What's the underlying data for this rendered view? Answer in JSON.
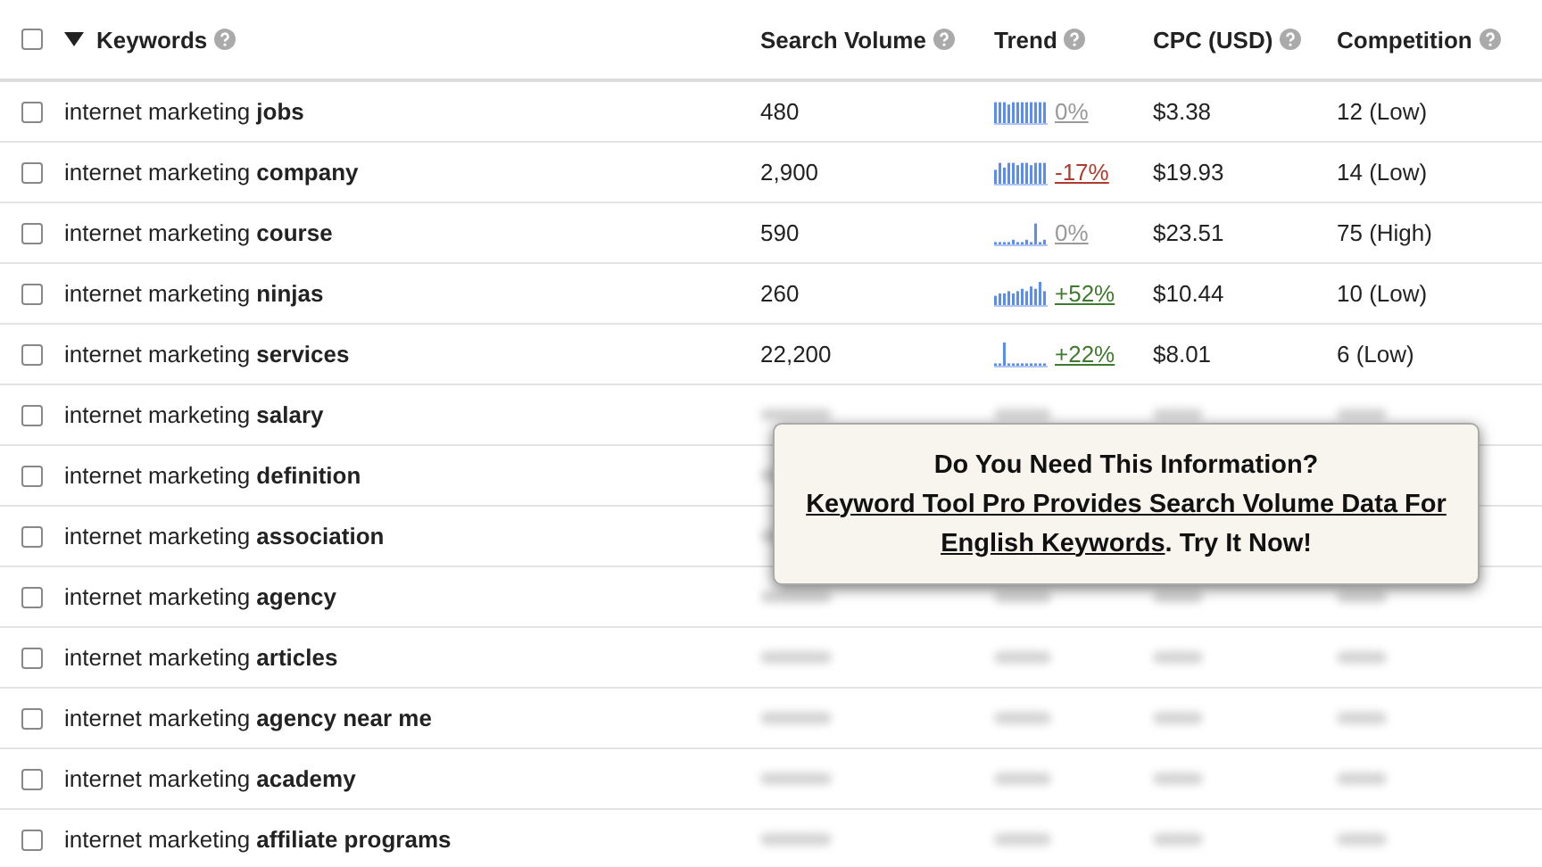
{
  "table": {
    "all_checked": false,
    "columns": [
      {
        "label": "Keywords",
        "sorted": true
      },
      {
        "label": "Search Volume",
        "sorted": false
      },
      {
        "label": "Trend",
        "sorted": false
      },
      {
        "label": "CPC (USD)",
        "sorted": false
      },
      {
        "label": "Competition",
        "sorted": false
      }
    ],
    "rows": [
      {
        "keyword": "internet marketing **jobs**",
        "checked": false,
        "locked": false,
        "volume": "480",
        "trend_change": "0%",
        "color": "#999999",
        "cpc": "$3.38",
        "competition": "12 (Low)"
      },
      {
        "keyword": "internet marketing **company**",
        "checked": false,
        "locked": false,
        "volume": "2,900",
        "trend_change": "-17%",
        "color": "#b03a2e",
        "cpc": "$19.93",
        "competition": "14 (Low)"
      },
      {
        "keyword": "internet marketing **course**",
        "checked": false,
        "locked": false,
        "volume": "590",
        "trend_change": "0%",
        "color": "#999999",
        "cpc": "$23.51",
        "competition": "75 (High)"
      },
      {
        "keyword": "internet marketing **ninjas**",
        "checked": false,
        "locked": false,
        "volume": "260",
        "trend_change": "+52%",
        "color": "#3f7a2e",
        "cpc": "$10.44",
        "competition": "10 (Low)"
      },
      {
        "keyword": "internet marketing **services**",
        "checked": false,
        "locked": false,
        "volume": "22,200",
        "trend_change": "+22%",
        "color": "#3f7a2e",
        "cpc": "$8.01",
        "competition": "6 (Low)"
      },
      {
        "keyword": "internet marketing **salary**",
        "checked": false,
        "locked": true
      },
      {
        "keyword": "internet marketing **definition**",
        "checked": false,
        "locked": true
      },
      {
        "keyword": "internet marketing **association**",
        "checked": false,
        "locked": true
      },
      {
        "keyword": "internet marketing **agency**",
        "checked": false,
        "locked": true
      },
      {
        "keyword": "internet marketing **articles**",
        "checked": false,
        "locked": true
      },
      {
        "keyword": "internet marketing **agency near me**",
        "checked": false,
        "locked": true
      },
      {
        "keyword": "internet marketing **academy**",
        "checked": false,
        "locked": true
      },
      {
        "keyword": "internet marketing **affiliate programs**",
        "checked": false,
        "locked": true
      }
    ]
  },
  "popup": {
    "title": "Do You Need This Information?",
    "link_line_1": "Keyword Tool Pro Provides Search Volume Data For",
    "link_line_2": "English Keywords",
    "suffix": ". Try It Now!"
  }
}
